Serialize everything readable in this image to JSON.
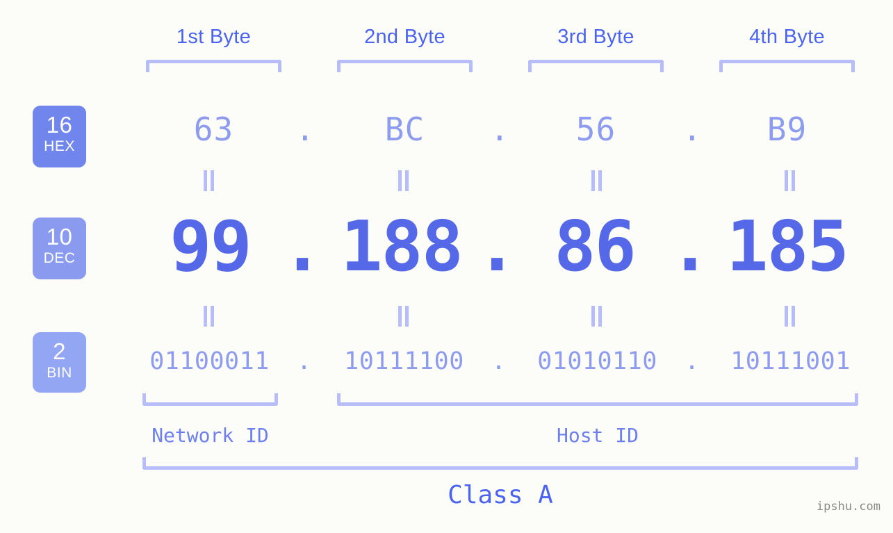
{
  "ip": {
    "dec_string": "99.188.86.185",
    "class": "Class A",
    "separator": "."
  },
  "byte_headers": [
    {
      "label": "1st Byte"
    },
    {
      "label": "2nd Byte"
    },
    {
      "label": "3rd Byte"
    },
    {
      "label": "4th Byte"
    }
  ],
  "radix_badges": [
    {
      "base": "16",
      "system": "HEX",
      "color": "#7186ec"
    },
    {
      "base": "10",
      "system": "DEC",
      "color": "#8a9bef"
    },
    {
      "base": "2",
      "system": "BIN",
      "color": "#92a6f3"
    }
  ],
  "rows": {
    "hex": {
      "values": [
        "63",
        "BC",
        "56",
        "B9"
      ]
    },
    "dec": {
      "values": [
        "99",
        "188",
        "86",
        "185"
      ]
    },
    "bin": {
      "values": [
        "01100011",
        "10111100",
        "01010110",
        "10111001"
      ]
    }
  },
  "equivalence_symbol": "||",
  "segments": {
    "network_id": "Network ID",
    "host_id": "Host ID"
  },
  "watermark": "ipshu.com",
  "colors": {
    "background": "#fcfdf9",
    "bracket": "#b6bdf8",
    "header_text": "#4a63f0",
    "hex_text": "#8e9cf0",
    "dec_text": "#5468e8",
    "bin_text": "#8e9cf0",
    "label_text": "#6d80ee"
  }
}
